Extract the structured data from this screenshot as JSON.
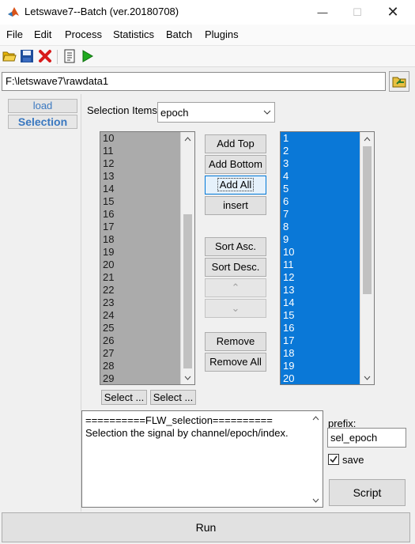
{
  "window": {
    "title": "Letswave7--Batch (ver.20180708)",
    "minimize_glyph": "—",
    "maximize_glyph": "☐",
    "close_glyph": "✕"
  },
  "menu": [
    "File",
    "Edit",
    "Process",
    "Statistics",
    "Batch",
    "Plugins"
  ],
  "toolbar": {
    "icons": [
      "open-folder-icon",
      "save-disk-icon",
      "delete-x-icon",
      "script-doc-icon",
      "run-play-icon"
    ],
    "accent_colors": {
      "folder": "#e8b400",
      "disk": "#1f4e9c",
      "delete": "#d81b1b",
      "play": "#1faa1f"
    }
  },
  "path": {
    "value": "F:\\letswave7\\rawdata1"
  },
  "tabs": {
    "load": "load",
    "selection": "Selection"
  },
  "selection": {
    "label": "Selection Items",
    "value": "epoch"
  },
  "left_list": {
    "items": [
      "10",
      "11",
      "12",
      "13",
      "14",
      "15",
      "16",
      "17",
      "18",
      "19",
      "20",
      "21",
      "22",
      "23",
      "24",
      "25",
      "26",
      "27",
      "28",
      "29"
    ],
    "select_button_1": "Select ...",
    "select_button_2": "Select ..."
  },
  "right_list": {
    "items": [
      "1",
      "2",
      "3",
      "4",
      "5",
      "6",
      "7",
      "8",
      "9",
      "10",
      "11",
      "12",
      "13",
      "14",
      "15",
      "16",
      "17",
      "18",
      "19",
      "20"
    ]
  },
  "buttons": {
    "add_top": "Add Top",
    "add_bottom": "Add Bottom",
    "add_all": "Add All",
    "insert": "insert",
    "sort_asc": "Sort Asc.",
    "sort_desc": "Sort Desc.",
    "move_up": "⌃",
    "move_down": "⌄",
    "remove": "Remove",
    "remove_all": "Remove All",
    "script": "Script",
    "run": "Run"
  },
  "info": {
    "line1": "==========FLW_selection==========",
    "line2": "Selection the signal by channel/epoch/index."
  },
  "prefix": {
    "label": "prefix:",
    "value": "sel_epoch"
  },
  "save": {
    "label": "save",
    "checked": true
  },
  "colors": {
    "list_selected_bg": "#0a78d7",
    "list_unselected_bg": "#ababab",
    "tab_text": "#3a78c0"
  }
}
